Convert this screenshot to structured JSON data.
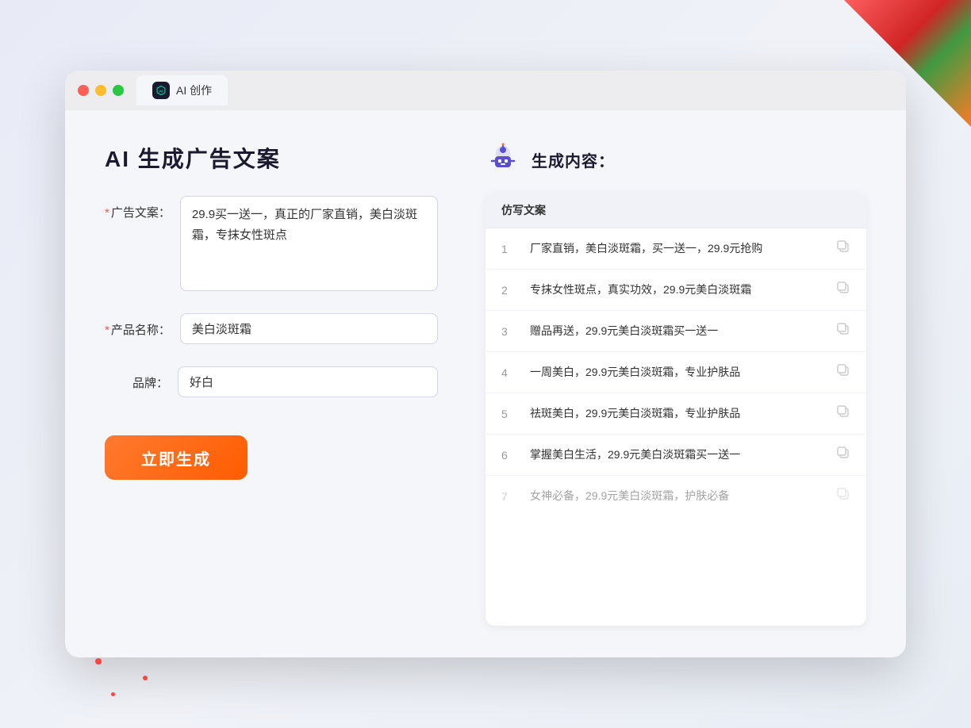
{
  "decorative": {
    "corner": "top-right"
  },
  "browser": {
    "tab_label": "AI 创作",
    "tab_icon_alt": "AI logo"
  },
  "left_panel": {
    "page_title": "AI 生成广告文案",
    "form": {
      "ad_copy_label": "广告文案：",
      "ad_copy_required": "＊",
      "ad_copy_value": "29.9买一送一，真正的厂家直销，美白淡斑霜，专抹女性斑点",
      "product_name_label": "产品名称：",
      "product_name_required": "＊",
      "product_name_value": "美白淡斑霜",
      "brand_label": "品牌：",
      "brand_value": "好白",
      "generate_btn_label": "立即生成"
    }
  },
  "right_panel": {
    "section_title": "生成内容：",
    "table_header": "仿写文案",
    "rows": [
      {
        "num": "1",
        "text": "厂家直销，美白淡斑霜，买一送一，29.9元抢购",
        "faded": false
      },
      {
        "num": "2",
        "text": "专抹女性斑点，真实功效，29.9元美白淡斑霜",
        "faded": false
      },
      {
        "num": "3",
        "text": "赠品再送，29.9元美白淡斑霜买一送一",
        "faded": false
      },
      {
        "num": "4",
        "text": "一周美白，29.9元美白淡斑霜，专业护肤品",
        "faded": false
      },
      {
        "num": "5",
        "text": "祛斑美白，29.9元美白淡斑霜，专业护肤品",
        "faded": false
      },
      {
        "num": "6",
        "text": "掌握美白生活，29.9元美白淡斑霜买一送一",
        "faded": false
      },
      {
        "num": "7",
        "text": "女神必备，29.9元美白淡斑霜，护肤必备",
        "faded": true
      }
    ]
  }
}
